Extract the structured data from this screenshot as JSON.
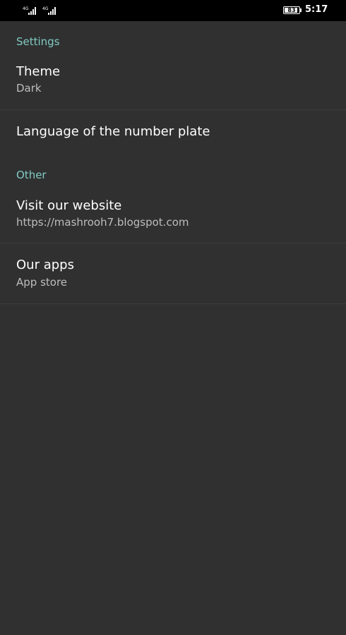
{
  "status_bar": {
    "signal_1_label": "4G",
    "signal_2_label": "4G",
    "battery_level": "83",
    "time": "5:17"
  },
  "settings_category": "Settings",
  "theme": {
    "title": "Theme",
    "summary": "Dark"
  },
  "language": {
    "title": "Language of the number plate"
  },
  "other_category": "Other",
  "website": {
    "title": "Visit our website",
    "summary": "https://mashrooh7.blogspot.com"
  },
  "apps": {
    "title": "Our apps",
    "summary": "App store"
  },
  "colors": {
    "background": "#303030",
    "accent": "#80CBC4",
    "status_bar": "#000000"
  }
}
